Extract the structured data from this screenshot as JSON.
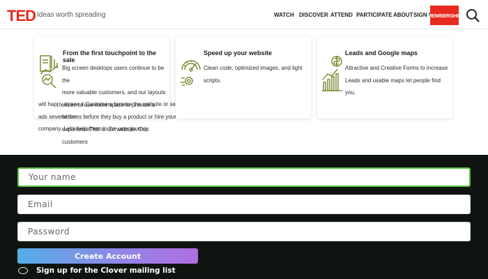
{
  "header": {
    "logo": "TED",
    "tagline": "Ideas worth spreading",
    "nav": [
      "WATCH",
      "DISCOVER",
      "ATTEND",
      "PARTICIPATE",
      "ABOUT",
      "SIGN IN"
    ],
    "membership_label": "MEMBERSHIP",
    "search_icon": "search-icon",
    "brand_color": "#e62b1e"
  },
  "cards": [
    {
      "icon": "marketing-chart-icon",
      "title": "From the first touchpoint to the sale",
      "lines": [
        "Big screen desktops users continue to be the",
        "more valuable customers, and our layouts",
        "widen to use more space to provide a better",
        "experienceThis is our website. Our customers",
        "will happy to see it.Customers browse the website or see",
        "ads several times before they buy a product or hire your",
        "company. Let's help them in the user journey."
      ]
    },
    {
      "icon": "speedometer-icon",
      "title": "Speed up your website",
      "lines": [
        "Clean code, optimized images, and light",
        "scripts."
      ]
    },
    {
      "icon": "location-chart-icon",
      "title": "Leads and Google maps",
      "lines": [
        "Attractive and Creative Forms to increase",
        "Leads and usable maps let people find you."
      ]
    }
  ],
  "signup": {
    "name_placeholder": "Your name",
    "email_placeholder": "Email",
    "password_placeholder": "Password",
    "create_label": "Create Account",
    "mailing_label": "Sign up for the Clover mailing list",
    "focus_color": "#58c13f"
  }
}
